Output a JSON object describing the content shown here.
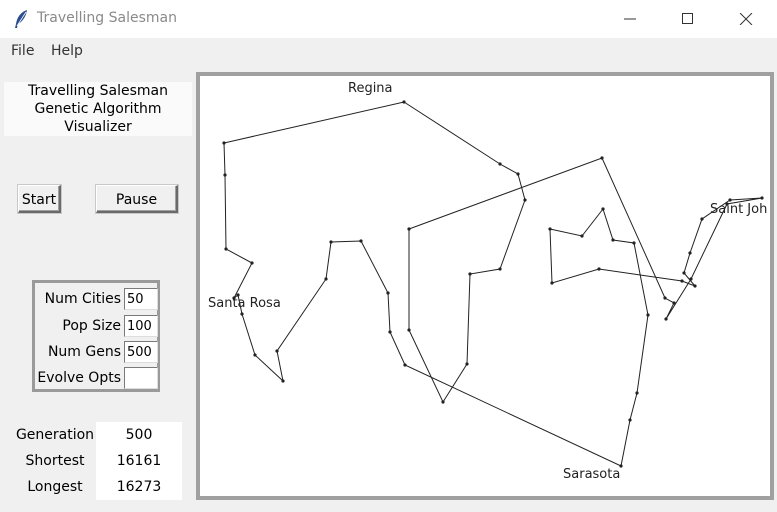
{
  "window": {
    "title": "Travelling Salesman",
    "icon": "feather-icon"
  },
  "menu": {
    "items": [
      "File",
      "Help"
    ]
  },
  "panel": {
    "title_line1": "Travelling Salesman",
    "title_line2": "Genetic Algorithm Visualizer"
  },
  "buttons": {
    "start": "Start",
    "pause": "Pause"
  },
  "params": {
    "num_cities_label": "Num Cities",
    "num_cities_value": "50",
    "pop_size_label": "Pop Size",
    "pop_size_value": "100",
    "num_gens_label": "Num Gens",
    "num_gens_value": "500",
    "evolve_opts_label": "Evolve Opts",
    "evolve_opts_value": ""
  },
  "stats": {
    "generation_label": "Generation",
    "generation_value": "500",
    "shortest_label": "Shortest",
    "shortest_value": "16161",
    "longest_label": "Longest",
    "longest_value": "16273"
  },
  "map": {
    "city_labels": [
      "Regina",
      "Saint Joh",
      "Santa Rosa",
      "Sarasota"
    ]
  }
}
